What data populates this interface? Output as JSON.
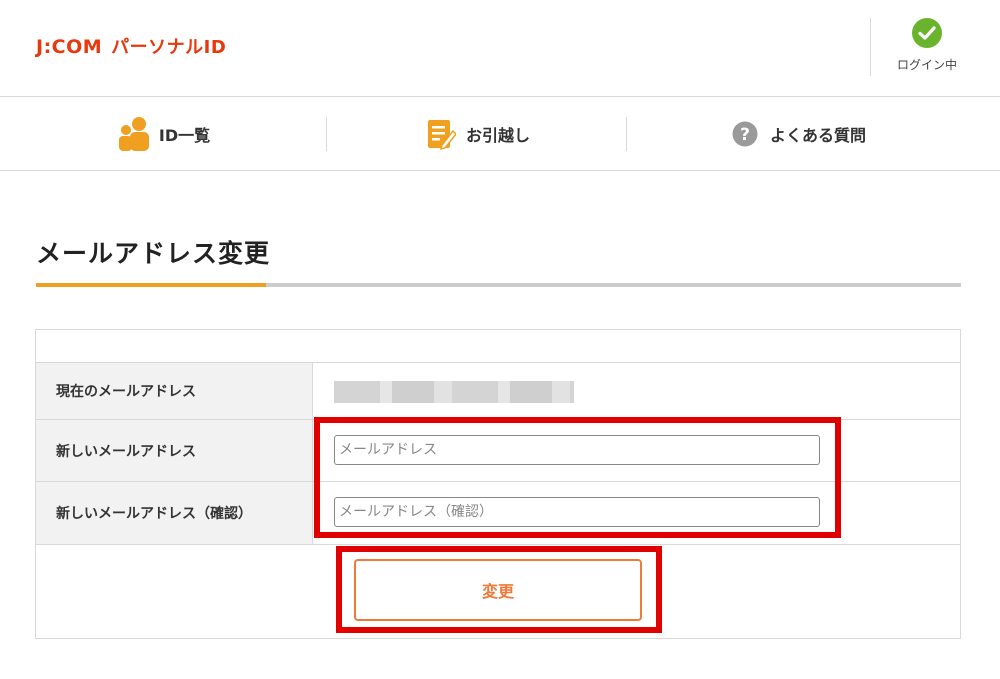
{
  "header": {
    "logo_brand": "J:COM",
    "logo_product": "パーソナルID",
    "login_status": "ログイン中"
  },
  "nav": {
    "items": [
      {
        "label": "ID一覧",
        "icon": "users-icon"
      },
      {
        "label": "お引越し",
        "icon": "edit-note-icon"
      },
      {
        "label": "よくある質問",
        "icon": "question-icon"
      }
    ]
  },
  "page": {
    "title": "メールアドレス変更"
  },
  "form": {
    "current_email_label": "現在のメールアドレス",
    "current_email_value_masked": true,
    "new_email_label": "新しいメールアドレス",
    "new_email_placeholder": "メールアドレス",
    "new_email_value": "",
    "confirm_email_label": "新しいメールアドレス（確認）",
    "confirm_email_placeholder": "メールアドレス（確認）",
    "confirm_email_value": "",
    "submit_label": "変更"
  },
  "colors": {
    "brand": "#e8380d",
    "accent": "#f0a020",
    "button": "#f07a3a",
    "highlight": "#e00000",
    "success": "#6ab42d"
  }
}
